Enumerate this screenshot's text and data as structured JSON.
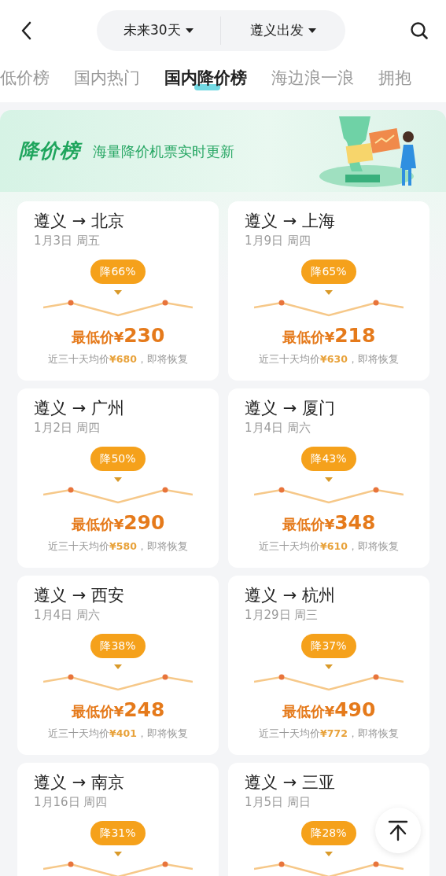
{
  "header": {
    "filters": [
      {
        "label": "未来30天"
      },
      {
        "label": "遵义出发"
      }
    ]
  },
  "tabs": [
    {
      "label": "低价榜",
      "selected": false
    },
    {
      "label": "国内热门",
      "selected": false
    },
    {
      "label": "国内降价榜",
      "selected": true
    },
    {
      "label": "海边浪一浪",
      "selected": false
    },
    {
      "label": "拥抱",
      "selected": false
    }
  ],
  "banner": {
    "title": "降价榜",
    "subtitle": "海量降价机票实时更新"
  },
  "deals": [
    {
      "origin": "遵义",
      "arrow": "→",
      "destination": "北京",
      "date": "1月3日 周五",
      "discount": "降66%",
      "price_prefix": "最低价¥",
      "price": "230",
      "average": "近三十天均价**¥680**，即将恢复"
    },
    {
      "origin": "遵义",
      "arrow": "→",
      "destination": "上海",
      "date": "1月9日 周四",
      "discount": "降65%",
      "price_prefix": "最低价¥",
      "price": "218",
      "average": "近三十天均价**¥630**，即将恢复"
    },
    {
      "origin": "遵义",
      "arrow": "→",
      "destination": "广州",
      "date": "1月2日 周四",
      "discount": "降50%",
      "price_prefix": "最低价¥",
      "price": "290",
      "average": "近三十天均价**¥580**，即将恢复"
    },
    {
      "origin": "遵义",
      "arrow": "→",
      "destination": "厦门",
      "date": "1月4日 周六",
      "discount": "降43%",
      "price_prefix": "最低价¥",
      "price": "348",
      "average": "近三十天均价**¥610**，即将恢复"
    },
    {
      "origin": "遵义",
      "arrow": "→",
      "destination": "西安",
      "date": "1月4日 周六",
      "discount": "降38%",
      "price_prefix": "最低价¥",
      "price": "248",
      "average": "近三十天均价**¥401**，即将恢复"
    },
    {
      "origin": "遵义",
      "arrow": "→",
      "destination": "杭州",
      "date": "1月29日 周三",
      "discount": "降37%",
      "price_prefix": "最低价¥",
      "price": "490",
      "average": "近三十天均价**¥772**，即将恢复"
    },
    {
      "origin": "遵义",
      "arrow": "→",
      "destination": "南京",
      "date": "1月16日 周四",
      "discount": "降31%"
    },
    {
      "origin": "遵义",
      "arrow": "→",
      "destination": "三亚",
      "date": "1月5日 周日",
      "discount": "降28%"
    }
  ]
}
